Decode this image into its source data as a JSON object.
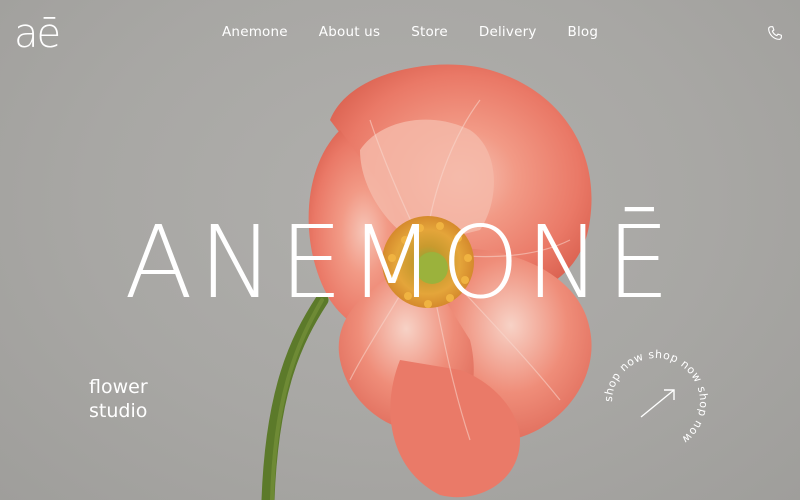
{
  "brand": {
    "logo_text": "aē"
  },
  "nav": {
    "items": [
      {
        "label": "Anemone"
      },
      {
        "label": "About us"
      },
      {
        "label": "Store"
      },
      {
        "label": "Delivery"
      },
      {
        "label": "Blog"
      }
    ]
  },
  "header": {
    "phone_icon": "phone-icon"
  },
  "hero": {
    "title": "ANEMONĒ",
    "tagline_line1": "flower",
    "tagline_line2": "studio",
    "shop_badge_text": "shop now shop now shop now ",
    "shop_badge_icon": "arrow-up-right-icon"
  },
  "colors": {
    "background": "#a9a9a7",
    "text": "#ffffff",
    "petal": "#ec7f6c",
    "stem": "#5c7a2a",
    "center": "#e0a03a"
  }
}
